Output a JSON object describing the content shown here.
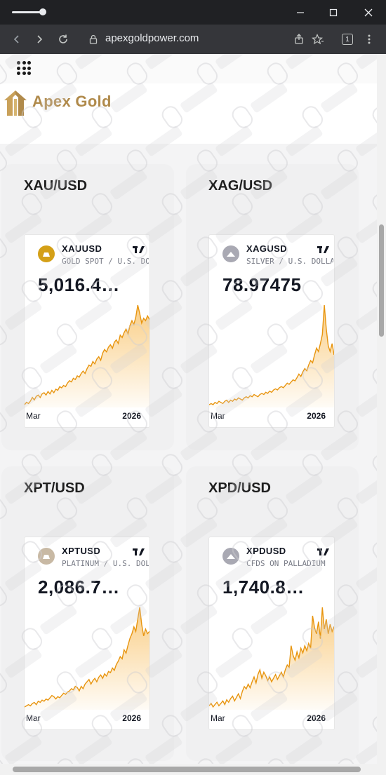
{
  "browser": {
    "url": "apexgoldpower.com",
    "tab_count": "1"
  },
  "site": {
    "brand": "Apex Gold",
    "accent_color": "#b08a4b"
  },
  "cards": [
    {
      "pair": "XAU/USD",
      "symbol": "XAUUSD",
      "description": "GOLD SPOT / U.S. DOLLAR",
      "price": "5,016.4…",
      "coin_color": "#d4a017",
      "x_start": "Mar",
      "x_end": "2026",
      "series": [
        12,
        14,
        13,
        15,
        18,
        16,
        19,
        20,
        18,
        21,
        22,
        20,
        23,
        21,
        24,
        22,
        25,
        24,
        27,
        26,
        28,
        27,
        30,
        32,
        31,
        34,
        33,
        36,
        35,
        38,
        40,
        38,
        42,
        45,
        44,
        48,
        46,
        50,
        52,
        49,
        55,
        58,
        56,
        60,
        62,
        59,
        64,
        66,
        63,
        70,
        68,
        72,
        75,
        71,
        78,
        82,
        79,
        85,
        95,
        88,
        80,
        84,
        82,
        86,
        83
      ]
    },
    {
      "pair": "XAG/USD",
      "symbol": "XAGUSD",
      "description": "SILVER / U.S. DOLLAR",
      "price": "78.97475",
      "coin_color": "#a9a9b3",
      "x_start": "Mar",
      "x_end": "2026",
      "series": [
        8,
        9,
        8,
        10,
        9,
        11,
        10,
        9,
        11,
        12,
        10,
        12,
        11,
        13,
        12,
        14,
        13,
        12,
        14,
        15,
        14,
        16,
        15,
        17,
        16,
        15,
        17,
        18,
        17,
        19,
        18,
        20,
        19,
        21,
        22,
        21,
        23,
        24,
        23,
        25,
        27,
        26,
        28,
        30,
        29,
        32,
        35,
        33,
        37,
        40,
        38,
        43,
        47,
        45,
        52,
        58,
        55,
        62,
        70,
        96,
        75,
        60,
        55,
        62,
        52
      ]
    },
    {
      "pair": "XPT/USD",
      "symbol": "XPTUSD",
      "description": "PLATINUM / U.S. DOLLAR",
      "price": "2,086.7…",
      "coin_color": "#c8b9a4",
      "x_start": "Mar",
      "x_end": "2026",
      "series": [
        8,
        9,
        10,
        9,
        11,
        12,
        10,
        13,
        12,
        14,
        13,
        15,
        14,
        16,
        18,
        17,
        15,
        17,
        16,
        18,
        20,
        19,
        21,
        22,
        24,
        23,
        26,
        25,
        22,
        26,
        24,
        28,
        30,
        32,
        28,
        31,
        33,
        30,
        34,
        36,
        33,
        37,
        35,
        39,
        38,
        42,
        40,
        45,
        48,
        52,
        50,
        58,
        55,
        62,
        68,
        72,
        78,
        74,
        85,
        95,
        80,
        70,
        76,
        72,
        74
      ]
    },
    {
      "pair": "XPD/USD",
      "symbol": "XPDUSD",
      "description": "CFDS ON PALLADIUM",
      "price": "1,740.8…",
      "coin_color": "#a9a9b3",
      "x_start": "Mar",
      "x_end": "2026",
      "series": [
        10,
        12,
        9,
        11,
        13,
        10,
        12,
        14,
        11,
        15,
        13,
        16,
        18,
        14,
        17,
        20,
        16,
        22,
        26,
        24,
        28,
        25,
        30,
        34,
        29,
        36,
        40,
        33,
        38,
        35,
        31,
        34,
        30,
        33,
        36,
        32,
        35,
        38,
        34,
        40,
        44,
        42,
        60,
        52,
        48,
        55,
        50,
        58,
        54,
        60,
        56,
        62,
        58,
        85,
        75,
        70,
        80,
        66,
        92,
        74,
        82,
        70,
        78,
        72,
        76
      ]
    }
  ]
}
